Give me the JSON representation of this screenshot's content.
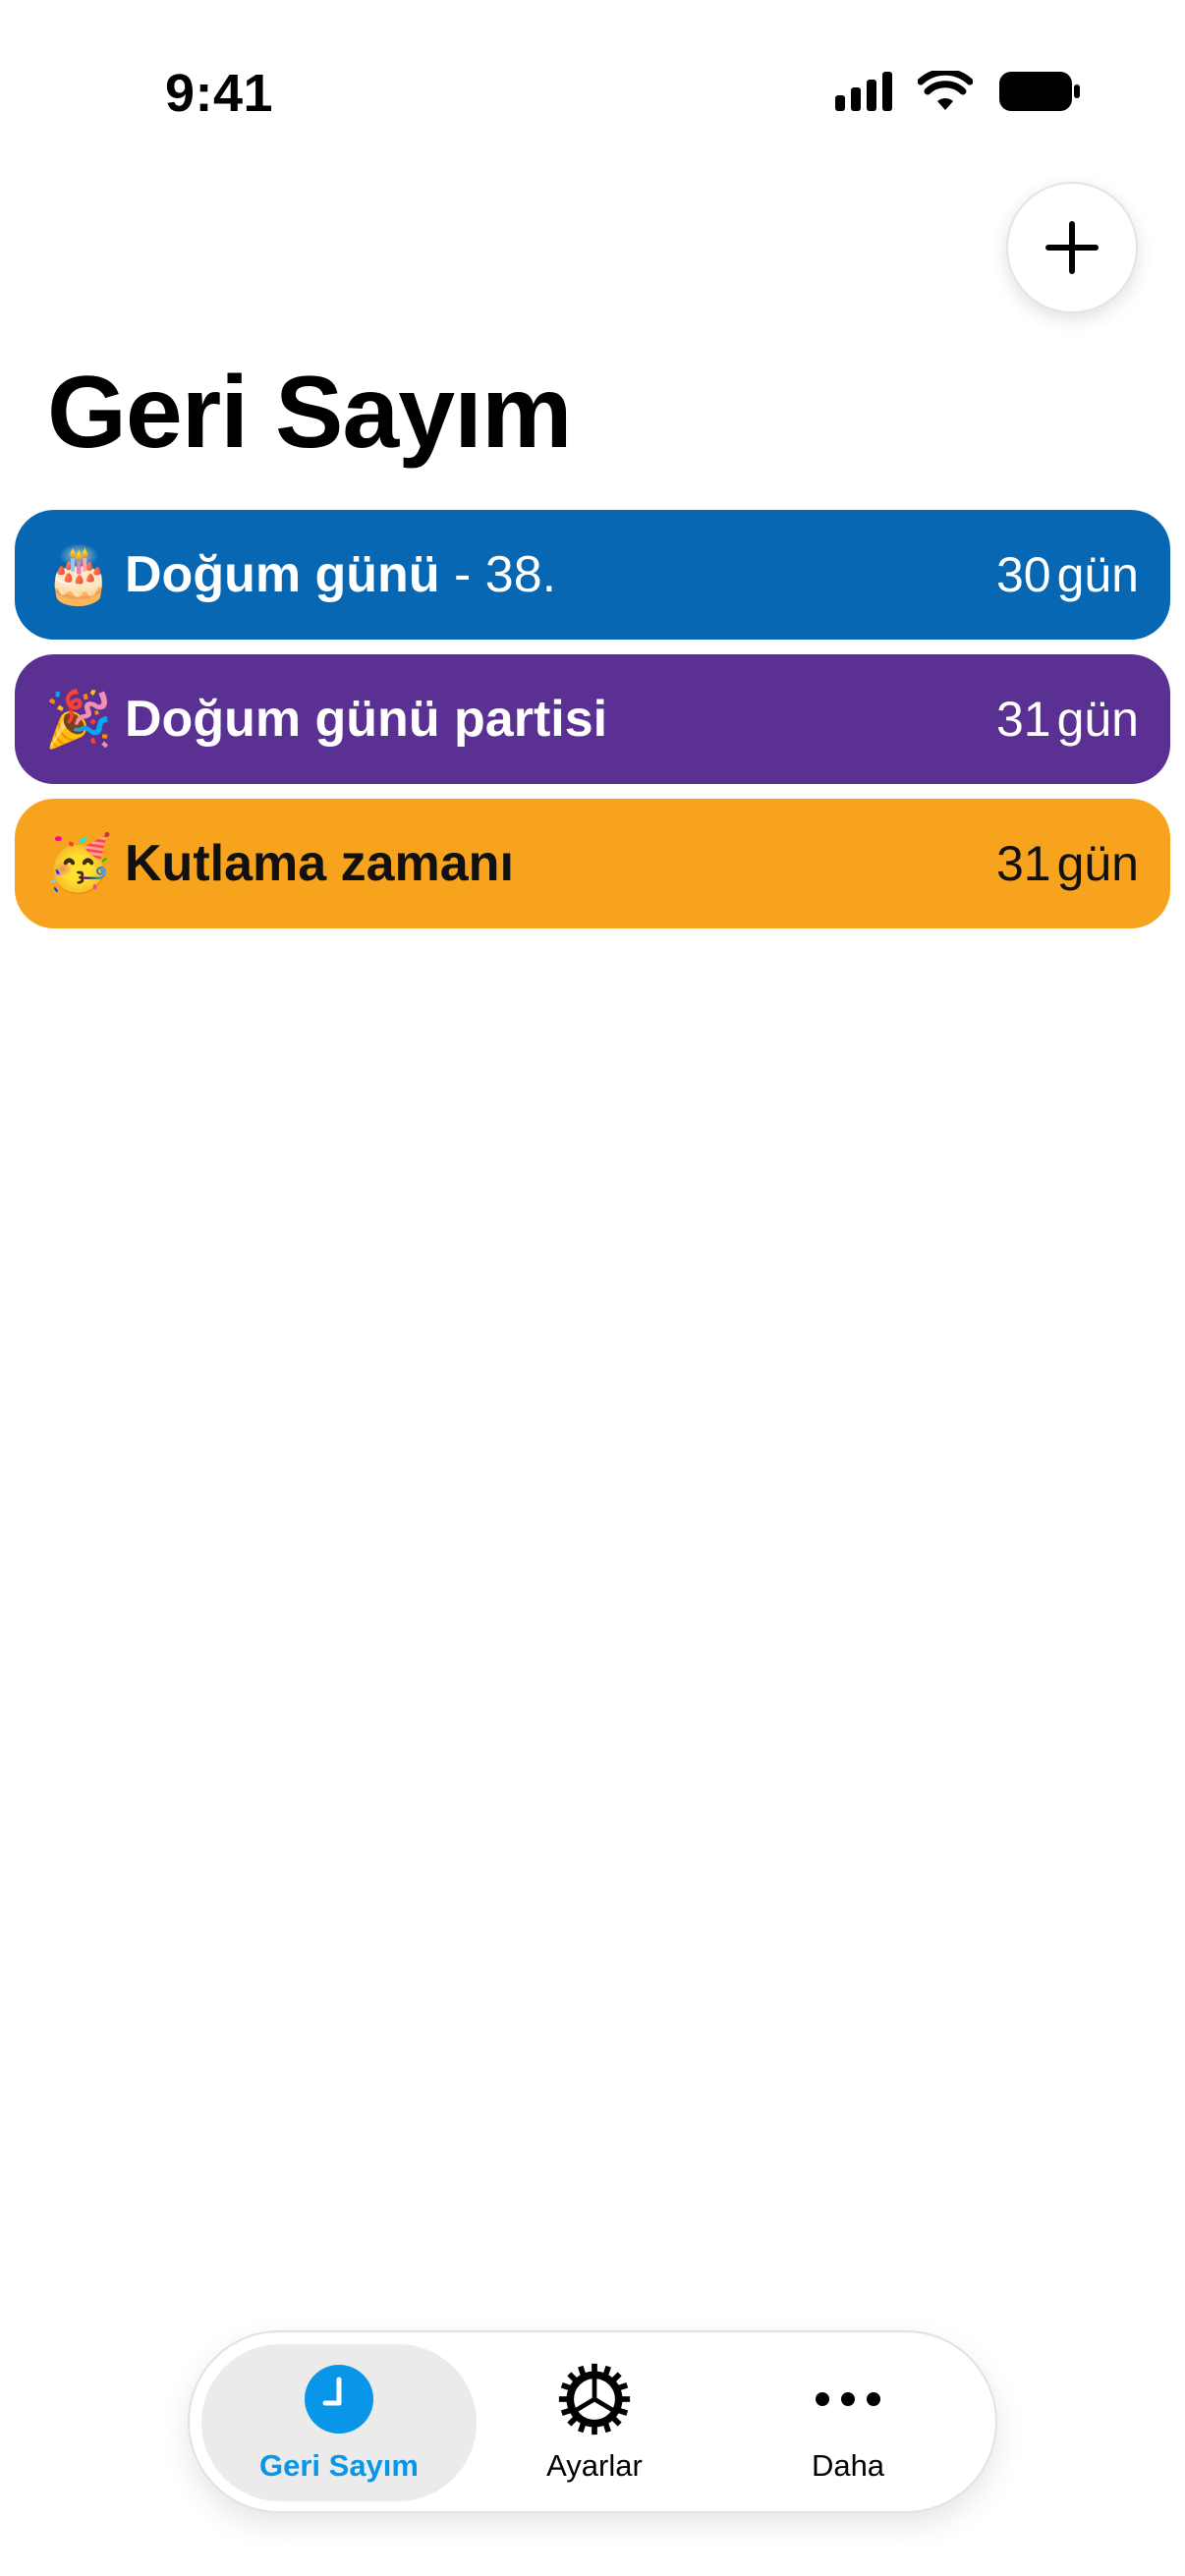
{
  "status_bar": {
    "time": "9:41",
    "icons": [
      "cellular-signal-icon",
      "wifi-icon",
      "battery-icon"
    ]
  },
  "header": {
    "add_icon": "plus-icon",
    "title": "Geri Sayım"
  },
  "countdowns": [
    {
      "emoji": "🎂",
      "title": "Doğum günü",
      "suffix": " - 38.",
      "days": "30",
      "unit": "gün",
      "color": "#0767b3"
    },
    {
      "emoji": "🎉",
      "title": "Doğum günü partisi",
      "suffix": "",
      "days": "31",
      "unit": "gün",
      "color": "#5a3093"
    },
    {
      "emoji": "🥳",
      "title": "Kutlama zamanı",
      "suffix": "",
      "days": "31",
      "unit": "gün",
      "color": "#f8a31d"
    }
  ],
  "tabbar": {
    "tabs": [
      {
        "label": "Geri Sayım",
        "icon": "clock-icon",
        "active": true
      },
      {
        "label": "Ayarlar",
        "icon": "gear-icon",
        "active": false
      },
      {
        "label": "Daha",
        "icon": "more-icon",
        "active": false
      }
    ],
    "accent": "#0a96e8"
  }
}
